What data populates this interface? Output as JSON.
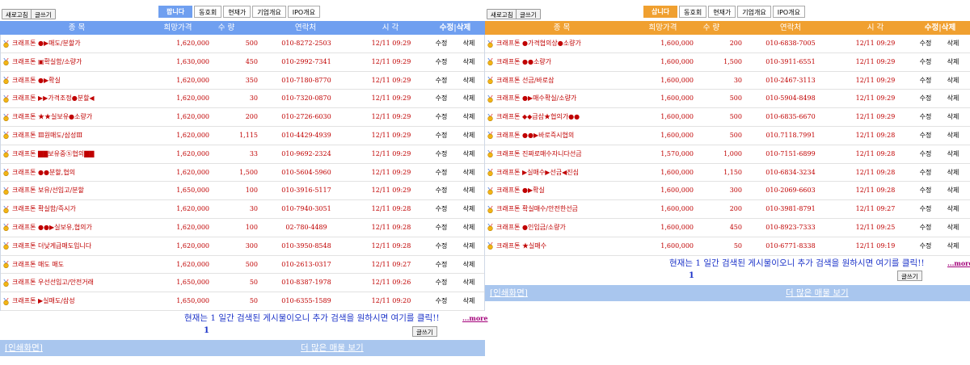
{
  "colors": {
    "blue": "#6f9ff0",
    "orange": "#f0a030",
    "price_red": "#c00000",
    "link_blue": "#1d34c9"
  },
  "left": {
    "toolbar": {
      "refresh": "새로고침",
      "write": "글쓰기"
    },
    "tabs": [
      "팝니다",
      "동호회",
      "현재가",
      "기업개요",
      "IPO개요"
    ],
    "headers": {
      "name": "종 목",
      "price": "희망가격",
      "qty": "수 량",
      "phone": "연락처",
      "time": "시 각",
      "editdel": "수정|삭제"
    },
    "rows": [
      {
        "name": "크래프톤 ●▶매도/분할가",
        "price": "1,620,000",
        "qty": "500",
        "phone": "010-8272-2503",
        "time": "12/11 09:29",
        "edit": "수정",
        "del": "삭제"
      },
      {
        "name": "크래프톤 ▣확실함/소량가",
        "price": "1,630,000",
        "qty": "450",
        "phone": "010-2992-7341",
        "time": "12/11 09:29",
        "edit": "수정",
        "del": "삭제"
      },
      {
        "name": "크래프톤 ●▶확실",
        "price": "1,620,000",
        "qty": "350",
        "phone": "010-7180-8770",
        "time": "12/11 09:29",
        "edit": "수정",
        "del": "삭제"
      },
      {
        "name": "크래프톤 ▶▶가격조정●분할◀",
        "price": "1,620,000",
        "qty": "30",
        "phone": "010-7320-0870",
        "time": "12/11 09:29",
        "edit": "수정",
        "del": "삭제"
      },
      {
        "name": "크래프톤 ★★실보유●소량가",
        "price": "1,620,000",
        "qty": "200",
        "phone": "010-2726-6030",
        "time": "12/11 09:29",
        "edit": "수정",
        "del": "삭제"
      },
      {
        "name": "크래프톤 Ⅲ원매도/삼성Ⅲ",
        "price": "1,620,000",
        "qty": "1,115",
        "phone": "010-4429-4939",
        "time": "12/11 09:29",
        "edit": "수정",
        "del": "삭제"
      },
      {
        "name": "크래프톤 ▇▇보유중⑤협의▇▇",
        "price": "1,620,000",
        "qty": "33",
        "phone": "010-9692-2324",
        "time": "12/11 09:29",
        "edit": "수정",
        "del": "삭제"
      },
      {
        "name": "크래프톤 ●●분할,협의",
        "price": "1,620,000",
        "qty": "1,500",
        "phone": "010-5604-5960",
        "time": "12/11 09:29",
        "edit": "수정",
        "del": "삭제"
      },
      {
        "name": "크래프톤 보유/선입고/분할",
        "price": "1,650,000",
        "qty": "100",
        "phone": "010-3916-5117",
        "time": "12/11 09:29",
        "edit": "수정",
        "del": "삭제"
      },
      {
        "name": "크래프톤 확실함/즉시가",
        "price": "1,620,000",
        "qty": "30",
        "phone": "010-7940-3051",
        "time": "12/11 09:28",
        "edit": "수정",
        "del": "삭제"
      },
      {
        "name": "크래프톤 ●●▶실보유,협의가",
        "price": "1,620,000",
        "qty": "100",
        "phone": "02-780-4489",
        "time": "12/11 09:28",
        "edit": "수정",
        "del": "삭제"
      },
      {
        "name": "크래프톤 더낮게급매도입니다",
        "price": "1,620,000",
        "qty": "300",
        "phone": "010-3950-8548",
        "time": "12/11 09:28",
        "edit": "수정",
        "del": "삭제"
      },
      {
        "name": "크래프톤 매도 매도",
        "price": "1,620,000",
        "qty": "500",
        "phone": "010-2613-0317",
        "time": "12/11 09:27",
        "edit": "수정",
        "del": "삭제"
      },
      {
        "name": "크래프톤 우선선입고/안전거래",
        "price": "1,650,000",
        "qty": "50",
        "phone": "010-8387-1978",
        "time": "12/11 09:26",
        "edit": "수정",
        "del": "삭제"
      },
      {
        "name": "크래프톤 ▶실매도/삼성",
        "price": "1,650,000",
        "qty": "50",
        "phone": "010-6355-1589",
        "time": "12/11 09:20",
        "edit": "수정",
        "del": "삭제"
      }
    ],
    "notice": "현재는 1 일간 검색된 게시물이오니 추가 검색을 원하시면 여기를 클릭!!",
    "more": "...more",
    "page": "1",
    "write2": "글쓰기",
    "print": "[인쇄화면]",
    "more_listings": "더 많은 매물 보기"
  },
  "right": {
    "toolbar": {
      "refresh": "새로고침",
      "write": "글쓰기"
    },
    "tabs": [
      "삽니다",
      "동호회",
      "현재가",
      "기업개요",
      "IPO개요"
    ],
    "headers": {
      "name": "종 목",
      "price": "희망가격",
      "qty": "수 량",
      "phone": "연락처",
      "time": "시 각",
      "editdel": "수정|삭제"
    },
    "rows": [
      {
        "name": "크래프톤 ●가격협의상●소량가",
        "price": "1,600,000",
        "qty": "200",
        "phone": "010-6838-7005",
        "time": "12/11 09:29",
        "edit": "수정",
        "del": "삭제"
      },
      {
        "name": "크래프톤 ●●소량가",
        "price": "1,600,000",
        "qty": "1,500",
        "phone": "010-3911-6551",
        "time": "12/11 09:29",
        "edit": "수정",
        "del": "삭제"
      },
      {
        "name": "크래프톤 선금/바로삼",
        "price": "1,600,000",
        "qty": "30",
        "phone": "010-2467-3113",
        "time": "12/11 09:29",
        "edit": "수정",
        "del": "삭제"
      },
      {
        "name": "크래프톤 ●▶매수확실/소량가",
        "price": "1,600,000",
        "qty": "500",
        "phone": "010-5904-8498",
        "time": "12/11 09:29",
        "edit": "수정",
        "del": "삭제"
      },
      {
        "name": "크래프톤 ◆◆급삼★협의가●●",
        "price": "1,600,000",
        "qty": "500",
        "phone": "010-6835-6670",
        "time": "12/11 09:29",
        "edit": "수정",
        "del": "삭제"
      },
      {
        "name": "크래프톤 ●●▶바로즉시협의",
        "price": "1,600,000",
        "qty": "500",
        "phone": "010.7118.7991",
        "time": "12/11 09:28",
        "edit": "수정",
        "del": "삭제"
      },
      {
        "name": "크래프톤 진짜로매수자니다선금",
        "price": "1,570,000",
        "qty": "1,000",
        "phone": "010-7151-6899",
        "time": "12/11 09:28",
        "edit": "수정",
        "del": "삭제"
      },
      {
        "name": "크래프톤 ▶실매수▶선금◀진심",
        "price": "1,600,000",
        "qty": "1,150",
        "phone": "010-6834-3234",
        "time": "12/11 09:28",
        "edit": "수정",
        "del": "삭제"
      },
      {
        "name": "크래프톤 ●▶확실",
        "price": "1,600,000",
        "qty": "300",
        "phone": "010-2069-6603",
        "time": "12/11 09:28",
        "edit": "수정",
        "del": "삭제"
      },
      {
        "name": "크래프톤 확실매수/안전한선금",
        "price": "1,600,000",
        "qty": "200",
        "phone": "010-3981-8791",
        "time": "12/11 09:27",
        "edit": "수정",
        "del": "삭제"
      },
      {
        "name": "크래프톤 ●인입금/소량가",
        "price": "1,600,000",
        "qty": "450",
        "phone": "010-8923-7333",
        "time": "12/11 09:25",
        "edit": "수정",
        "del": "삭제"
      },
      {
        "name": "크래프톤 ★실매수",
        "price": "1,600,000",
        "qty": "50",
        "phone": "010-6771-8338",
        "time": "12/11 09:19",
        "edit": "수정",
        "del": "삭제"
      }
    ],
    "notice": "현재는 1 일간 검색된 게시물이오니 추가 검색을 원하시면 여기를 클릭!!",
    "more": "...more",
    "page": "1",
    "write2": "글쓰기",
    "print": "[인쇄화면]",
    "more_listings": "더 많은 매물 보기"
  }
}
